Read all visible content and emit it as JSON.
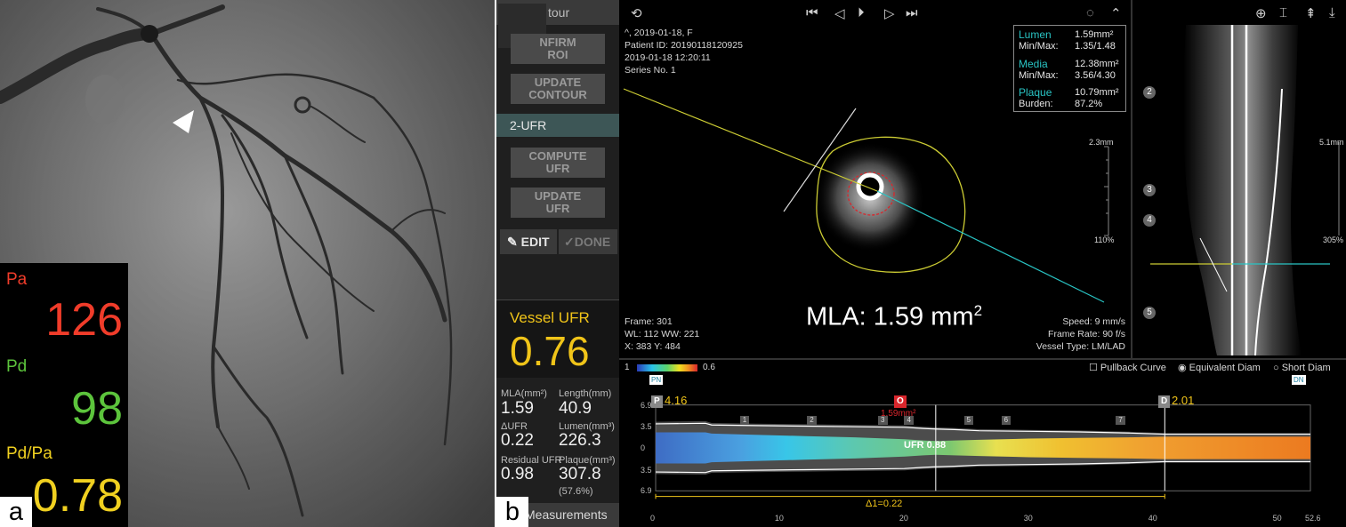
{
  "panel_a": {
    "letter": "a",
    "pressure": {
      "pa_label": "Pa",
      "pa_value": "126",
      "pd_label": "Pd",
      "pd_value": "98",
      "ratio_label": "Pd/Pa",
      "ratio_value": "0.78"
    },
    "colors": {
      "pa": "#f03c2a",
      "pd": "#5cc43c",
      "ratio": "#f0d020"
    }
  },
  "panel_b": {
    "letter": "b",
    "sidebar": {
      "contour_tab": "tour",
      "confirm_roi": "NFIRM\nROI",
      "update_contour": "UPDATE\nCONTOUR",
      "ufr_tab": "2-UFR",
      "compute_ufr": "COMPUTE\nUFR",
      "update_ufr": "UPDATE\nUFR",
      "edit": "EDIT",
      "done": "DONE",
      "vessel_ufr_label": "Vessel UFR",
      "vessel_ufr_value": "0.76",
      "measurements": [
        {
          "label": "MLA(mm²)",
          "value": "1.59"
        },
        {
          "label": "Length(mm)",
          "value": "40.9"
        },
        {
          "label": "ΔUFR",
          "value": "0.22"
        },
        {
          "label": "Lumen(mm³)",
          "value": "226.3"
        },
        {
          "label": "Residual UFR",
          "value": "0.98"
        },
        {
          "label": "Plaque(mm³)",
          "value": "307.8"
        }
      ],
      "plaque_percent": "(57.6%)",
      "measurements_tab": "Measurements"
    },
    "ivus": {
      "patient_lines": [
        "^, 2019-01-18, F",
        "Patient ID: 20190118120925",
        "2019-01-18 12:20:11",
        "Series No. 1"
      ],
      "frame_lines": [
        "Frame: 301",
        "WL: 112   WW: 221",
        "X: 383   Y: 484"
      ],
      "speed_lines": [
        "Speed: 9 mm/s",
        "Frame Rate: 90 f/s",
        "Vessel Type: LM/LAD"
      ],
      "scale_top": "2.3mm",
      "scale_bottom": "110%",
      "mla_label": "MLA: 1.59 mm",
      "mla_sup": "2",
      "table": {
        "lumen_label": "Lumen",
        "lumen_value": "1.59mm²",
        "lumen_mm_label": "Min/Max:",
        "lumen_mm_value": "1.35/1.48",
        "media_label": "Media",
        "media_value": "12.38mm²",
        "media_mm_label": "Min/Max:",
        "media_mm_value": "3.56/4.30",
        "plaque_label": "Plaque",
        "plaque_value": "10.79mm²",
        "burden_label": "Burden:",
        "burden_value": "87.2%"
      }
    },
    "longitudinal": {
      "scale_top": "5.1mm",
      "scale_bottom": "305%",
      "markers": [
        "2",
        "3",
        "4",
        "5"
      ]
    },
    "chart": {
      "colorbar_min": "1",
      "colorbar_max": "0.6",
      "options": [
        "Pullback Curve",
        "Equivalent Diam",
        "Short Diam"
      ],
      "selected_option": "Equivalent Diam",
      "pn_label": "PN",
      "dn_label": "DN",
      "p_label": "P",
      "p_value": "4.16",
      "o_label": "O",
      "o_value": "1.59mm²",
      "d_label": "D",
      "d_value": "2.01",
      "ufr_label": "UFR 0.88",
      "delta_label": "Δ1=0.22",
      "segment_labels": [
        "1",
        "2",
        "3",
        "4",
        "5",
        "6",
        "7"
      ]
    },
    "colors": {
      "accent_teal": "#29c4c4",
      "accent_yellow": "#f0c419",
      "marker_red": "#d9262c"
    }
  },
  "chart_data": {
    "type": "area",
    "title": "",
    "xlabel": "",
    "ylabel": "",
    "x_ticks": [
      "0",
      "10",
      "20",
      "30",
      "40",
      "50",
      "52.6"
    ],
    "y_ticks": [
      "6.9",
      "3.5",
      "0",
      "3.5",
      "6.9"
    ],
    "xlim": [
      0,
      52.6
    ],
    "ylim": [
      -6.9,
      6.9
    ],
    "markers": {
      "proximal_x": 0,
      "mla_x": 22.5,
      "distal_x": 40.9
    },
    "segments_x": [
      7.2,
      12.6,
      18.3,
      20.4,
      25.2,
      28.2,
      37.4
    ],
    "profile_x": [
      0,
      4,
      4.5,
      8,
      12,
      16,
      20,
      21.5,
      22.5,
      24,
      26,
      30,
      34,
      38,
      40.9,
      44,
      48,
      52.6
    ],
    "profile_halfwidth": [
      2.5,
      2.5,
      2.3,
      2.1,
      1.9,
      1.7,
      1.4,
      1.2,
      1.1,
      1.2,
      1.3,
      1.5,
      1.6,
      1.7,
      1.8,
      1.8,
      1.8,
      1.8
    ],
    "vessel_halfwidth": [
      4.2,
      4.3,
      4.0,
      3.9,
      3.8,
      3.7,
      3.6,
      3.4,
      3.3,
      3.2,
      3.0,
      2.9,
      2.8,
      2.6,
      2.4,
      2.4,
      2.4,
      2.4
    ]
  }
}
